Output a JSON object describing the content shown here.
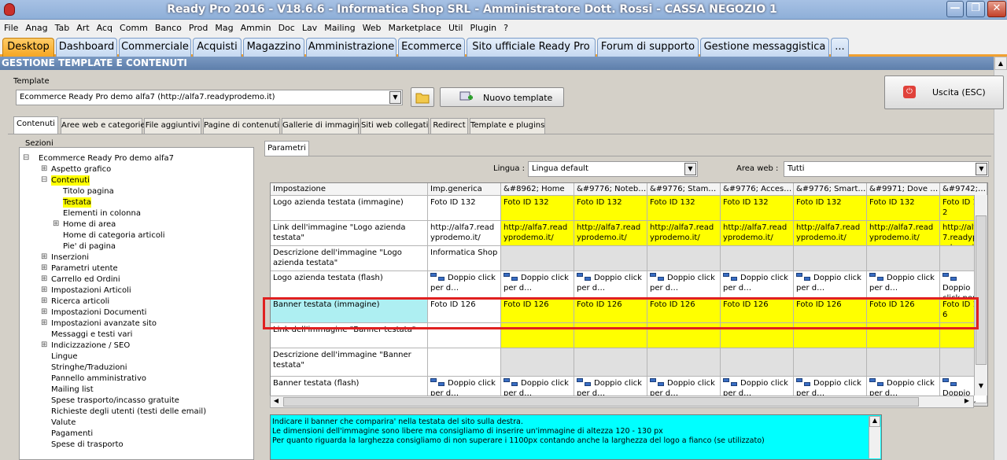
{
  "window": {
    "title": "Ready Pro 2016 - V18.6.6 - Informatica Shop SRL - Amministratore Dott. Rossi - CASSA NEGOZIO 1",
    "minimize_label": "—",
    "restore_label": "❐",
    "close_label": "✕"
  },
  "menu": [
    "File",
    "Anag",
    "Tab",
    "Art",
    "Acq",
    "Comm",
    "Banco",
    "Prod",
    "Mag",
    "Ammin",
    "Doc",
    "Lav",
    "Mailing",
    "Web",
    "Marketplace",
    "Util",
    "Plugin",
    "?"
  ],
  "main_tabs": [
    "Desktop",
    "Dashboard",
    "Commerciale",
    "Acquisti",
    "Magazzino",
    "Amministrazione",
    "Ecommerce",
    "Sito ufficiale Ready Pro",
    "Forum di supporto",
    "Gestione messaggistica",
    "..."
  ],
  "section_title": "GESTIONE TEMPLATE E CONTENUTI",
  "template": {
    "label": "Template",
    "value": "Ecommerce Ready Pro demo alfa7 (http://alfa7.readyprodemo.it)",
    "new_button": "Nuovo template"
  },
  "exit_button": "Uscita (ESC)",
  "sub_tabs": [
    "Contenuti",
    "Aree web e categorie",
    "File aggiuntivi",
    "Pagine di contenuti",
    "Gallerie di immagini",
    "Siti web collegati",
    "Redirect",
    "Template e plugins"
  ],
  "tree": {
    "label": "Sezioni",
    "root": "Ecommerce Ready Pro demo alfa7",
    "aspetto": "Aspetto grafico",
    "contenuti": "Contenuti",
    "titolo": "Titolo pagina",
    "testata": "Testata",
    "elementi": "Elementi in colonna",
    "home_area": "Home di area",
    "home_cat": "Home di categoria articoli",
    "pie": "Pie' di pagina",
    "rest": [
      "Inserzioni",
      "Parametri utente",
      "Carrello ed Ordini",
      "Impostazioni Articoli",
      "Ricerca articoli",
      "Impostazioni Documenti",
      "Impostazioni avanzate sito",
      "Messaggi e testi vari",
      "Indicizzazione / SEO",
      "Lingue",
      "Stringhe/Traduzioni",
      "Pannello amministrativo",
      "Mailing list",
      "Spese trasporto/incasso gratuite",
      "Richieste degli utenti (testi delle email)",
      "Valute",
      "Pagamenti",
      "Spese di trasporto"
    ]
  },
  "params_tab": "Parametri",
  "lingua": {
    "label": "Lingua :",
    "value": "Lingua default"
  },
  "area_web": {
    "label": "Area web :",
    "value": "Tutti"
  },
  "grid": {
    "headers": [
      "Impostazione",
      "Imp.generica",
      "&#8962; Home",
      "&#9776; Noteb…",
      "&#9776; Stam…",
      "&#9776; Acces…",
      "&#9776; Smart…",
      "&#9971; Dove …",
      "&#9742;…"
    ],
    "rows": [
      {
        "name": "Logo azienda testata (immagine)",
        "generic": "Foto ID 132",
        "value": "Foto ID 132"
      },
      {
        "name": "Link dell'immagine \"Logo azienda testata\"",
        "generic": "http://alfa7.readyprodemo.it/",
        "value": "http://alfa7.readyprodemo.it/"
      },
      {
        "name": "Descrizione dell'immagine \"Logo azienda testata\"",
        "generic": "Informatica Shop",
        "value": ""
      },
      {
        "name": "Logo azienda testata (flash)",
        "generic": "Doppio click per d…",
        "value": "Doppio click per d…"
      },
      {
        "name": "Banner testata (immagine)",
        "generic": "Foto ID 126",
        "value": "Foto ID 126"
      },
      {
        "name": "Link dell'immagine \"Banner testata\"",
        "generic": "",
        "value": ""
      },
      {
        "name": "Descrizione dell'immagine \"Banner testata\"",
        "generic": "",
        "value": ""
      },
      {
        "name": "Banner testata (flash)",
        "generic": "Doppio click per d…",
        "value": "Doppio click per d…"
      }
    ]
  },
  "note": [
    "Indicare il banner che comparira' nella testata del sito sulla destra.",
    "Le dimensioni dell'immagine sono libere ma consigliamo di inserire un'immagine di altezza 120 - 130 px",
    "Per quanto riguarda la larghezza consigliamo di non superare i 1100px contando anche la larghezza del logo a fianco (se utilizzato)"
  ]
}
